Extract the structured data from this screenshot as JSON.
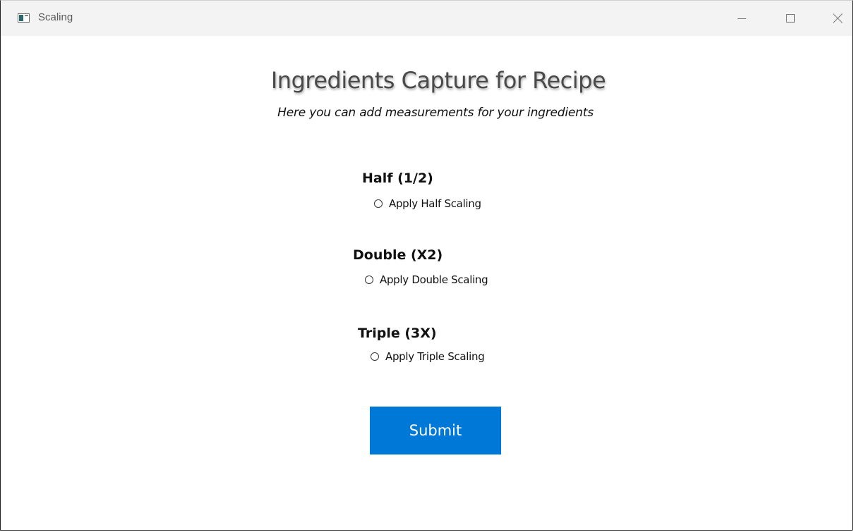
{
  "window": {
    "title": "Scaling"
  },
  "icons": {
    "app": "window-app-icon",
    "minimize": "minimize-icon",
    "maximize": "maximize-icon",
    "close": "close-icon"
  },
  "header": {
    "title": "Ingredients Capture for Recipe",
    "subtitle": "Here you can add measurements for your ingredients"
  },
  "options": [
    {
      "group_label": "Half (1/2)",
      "radio_label": "Apply Half Scaling",
      "checked": false
    },
    {
      "group_label": "Double (X2)",
      "radio_label": "Apply Double Scaling",
      "checked": false
    },
    {
      "group_label": "Triple (3X)",
      "radio_label": "Apply Triple Scaling",
      "checked": false
    }
  ],
  "actions": {
    "submit_label": "Submit"
  },
  "colors": {
    "accent": "#0078d7",
    "titlebar": "#f3f3f3"
  }
}
